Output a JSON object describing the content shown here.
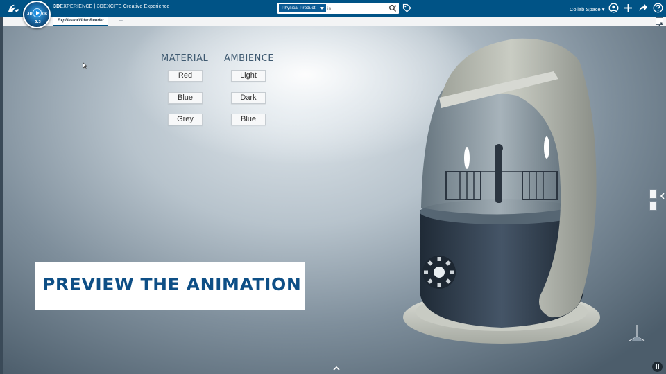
{
  "topbar": {
    "brand_prefix": "3D",
    "brand_text": "EXPERIENCE | 3DEXCITE Creative Experience",
    "compass_labels": {
      "left": "3D",
      "right": "V.R",
      "bottom": "5.3"
    },
    "search": {
      "scope": "Physical Product",
      "placeholder": "in"
    },
    "collab_space": "Collab Space"
  },
  "tabs": [
    {
      "label": "ExpNestorVideoRender",
      "active": true
    }
  ],
  "tab_add": "+",
  "configurator": {
    "material": {
      "heading": "MATERIAL",
      "options": [
        "Red",
        "Blue",
        "Grey"
      ]
    },
    "ambience": {
      "heading": "AMBIENCE",
      "options": [
        "Light",
        "Dark",
        "Blue"
      ]
    }
  },
  "banner": {
    "text": "PREVIEW THE ANIMATION"
  },
  "colors": {
    "topbar": "#005386",
    "heading": "#3e5970",
    "banner_text": "#0e4f86",
    "product_shell": "#b9bdb3",
    "product_base": "#2e3d4e"
  }
}
